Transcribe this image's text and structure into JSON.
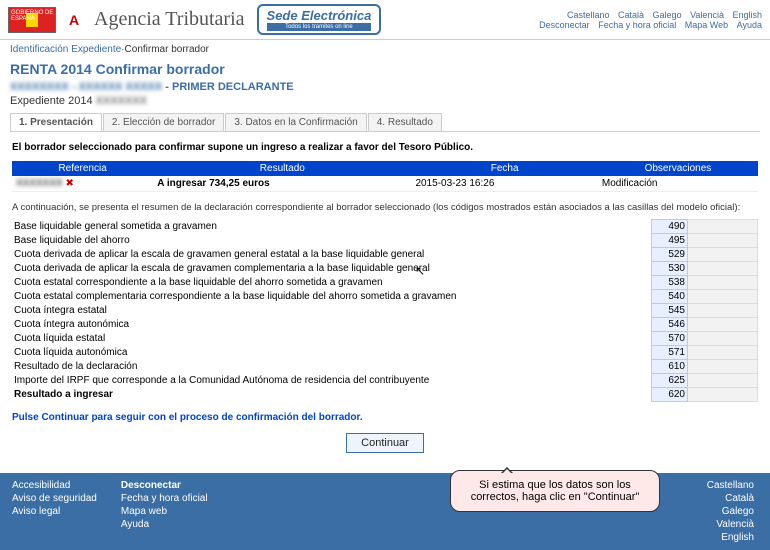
{
  "header": {
    "gob": "GOBIERNO DE ESPAÑA",
    "at_logo": "A",
    "title": "Agencia Tributaria",
    "sede_main": "Sede Electrónica",
    "sede_sub": "Todos los trámites on line",
    "langs": [
      "Castellano",
      "Català",
      "Galego",
      "Valencià",
      "English"
    ],
    "row2": {
      "desconectar": "Desconectar",
      "items": [
        "Fecha y hora oficial",
        "Mapa Web",
        "Ayuda"
      ]
    }
  },
  "crumb": {
    "a": "Identificación Expediente",
    "b": "Confirmar borrador"
  },
  "page": {
    "title": "RENTA 2014 Confirmar borrador",
    "subtitle_suffix": " - PRIMER DECLARANTE",
    "expediente": "Expediente 2014"
  },
  "tabs": [
    "1. Presentación",
    "2. Elección de borrador",
    "3. Datos en la Confirmación",
    "4. Resultado"
  ],
  "active_tab": 0,
  "intro": "El borrador seleccionado para confirmar supone un ingreso a realizar a favor del Tesoro Público.",
  "summary": {
    "headers": [
      "Referencia",
      "Resultado",
      "Fecha",
      "Observaciones"
    ],
    "row": {
      "ref": "",
      "resultado": "A ingresar 734,25 euros",
      "fecha": "2015-03-23 16:26",
      "obs": "Modificación"
    }
  },
  "note": "A continuación, se presenta el resumen de la declaración correspondiente al borrador seleccionado (los códigos mostrados están asociados a las casillas del modelo oficial):",
  "rows": [
    {
      "lbl": "Base liquidable general sometida a gravamen",
      "code": "490",
      "amt": ""
    },
    {
      "lbl": "Base liquidable del ahorro",
      "code": "495",
      "amt": ""
    },
    {
      "lbl": "Cuota derivada de aplicar la escala de gravamen general estatal a la base liquidable general",
      "code": "529",
      "amt": ""
    },
    {
      "lbl": "Cuota derivada de aplicar la escala de gravamen complementaria a la base liquidable general",
      "code": "530",
      "amt": ""
    },
    {
      "lbl": "Cuota estatal correspondiente a la base liquidable del ahorro sometida a gravamen",
      "code": "538",
      "amt": ""
    },
    {
      "lbl": "Cuota estatal complementaria correspondiente a la base liquidable del ahorro sometida a gravamen",
      "code": "540",
      "amt": ""
    },
    {
      "lbl": "Cuota íntegra estatal",
      "code": "545",
      "amt": ""
    },
    {
      "lbl": "Cuota íntegra autonómica",
      "code": "546",
      "amt": ""
    },
    {
      "lbl": "Cuota líquida estatal",
      "code": "570",
      "amt": ""
    },
    {
      "lbl": "Cuota líquida autonómica",
      "code": "571",
      "amt": ""
    },
    {
      "lbl": "Resultado de la declaración",
      "code": "610",
      "amt": ""
    },
    {
      "lbl": "Importe del IRPF que corresponde a la Comunidad Autónoma de residencia del contribuyente",
      "code": "625",
      "amt": ""
    },
    {
      "lbl": "Resultado a ingresar",
      "code": "620",
      "amt": "",
      "bold": true
    }
  ],
  "hint": "Pulse Continuar para seguir con el proceso de confirmación del borrador.",
  "button": "Continuar",
  "callout": "Si estima que los datos son los correctos, haga clic en \"Continuar\"",
  "footer": {
    "col1": [
      "Accesibilidad",
      "Aviso de seguridad",
      "Aviso legal"
    ],
    "col2_head": "Desconectar",
    "col2": [
      "Fecha y hora oficial",
      "Mapa web",
      "Ayuda"
    ],
    "col_right": [
      "Castellano",
      "Català",
      "Galego",
      "Valencià",
      "English"
    ]
  }
}
